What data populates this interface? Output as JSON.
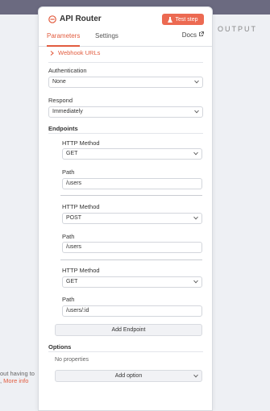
{
  "node": {
    "title": "API Router",
    "test_step_label": "Test step"
  },
  "tabs": [
    {
      "label": "Parameters",
      "active": true
    },
    {
      "label": "Settings",
      "active": false
    }
  ],
  "docs_label": "Docs",
  "webhook_label": "Webhook URLs",
  "authentication": {
    "label": "Authentication",
    "value": "None"
  },
  "respond": {
    "label": "Respond",
    "value": "Immediately"
  },
  "endpoints": {
    "label": "Endpoints",
    "items": [
      {
        "method_label": "HTTP Method",
        "method": "GET",
        "path_label": "Path",
        "path": "/users"
      },
      {
        "method_label": "HTTP Method",
        "method": "POST",
        "path_label": "Path",
        "path": "/users"
      },
      {
        "method_label": "HTTP Method",
        "method": "GET",
        "path_label": "Path",
        "path": "/users/:id"
      }
    ],
    "add_label": "Add Endpoint"
  },
  "options": {
    "label": "Options",
    "empty_text": "No properties",
    "add_label": "Add option"
  },
  "background": {
    "output_label": "OUTPUT",
    "side_text": "out having to",
    "more_info": "More info"
  },
  "colors": {
    "accent": "#e25c3f",
    "button": "#ec6a52",
    "topbar": "#6b6a80"
  }
}
